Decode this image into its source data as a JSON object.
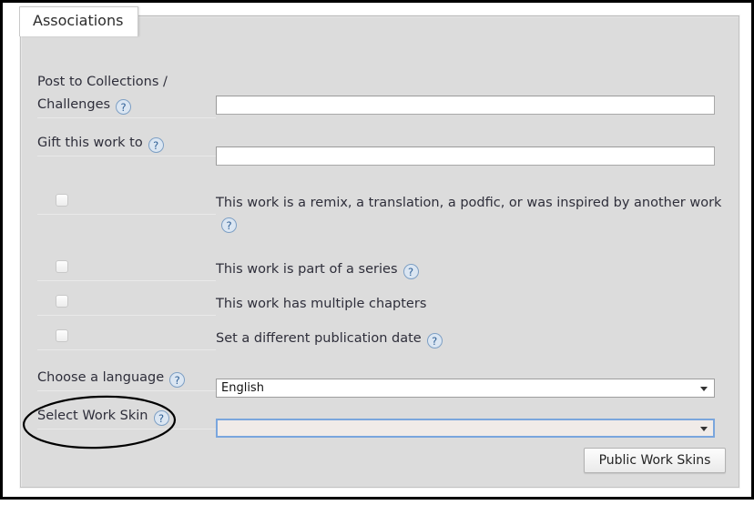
{
  "window": {
    "tab_label": "Associations"
  },
  "form": {
    "fields": [
      {
        "id": "post-to-collections",
        "label_line1": "Post to Collections /",
        "label_line2": "Challenges",
        "help_icon": "question-mark-icon",
        "help_glyph": "?",
        "input_value": "",
        "input_placeholder": ""
      },
      {
        "id": "gift-this-work-to",
        "label": "Gift this work to",
        "help_icon": "question-mark-icon",
        "help_glyph": "?",
        "input_value": "",
        "input_placeholder": ""
      }
    ],
    "checkboxes": [
      {
        "id": "remix-translation-podfic",
        "checked": false,
        "description": "This work is a remix, a translation, a podfic, or was inspired by another work",
        "has_help": true,
        "help_glyph": "?"
      },
      {
        "id": "part-of-series",
        "checked": false,
        "description": "This work is part of a series",
        "has_help": true,
        "help_glyph": "?"
      },
      {
        "id": "multiple-chapters",
        "checked": false,
        "description": "This work has multiple chapters",
        "has_help": false,
        "help_glyph": "?"
      },
      {
        "id": "different-publication-date",
        "checked": false,
        "description": "Set a different publication date",
        "has_help": true,
        "help_glyph": "?"
      }
    ],
    "language": {
      "label": "Choose a language",
      "help_glyph": "?",
      "selected": "English"
    },
    "work_skin": {
      "label": "Select Work Skin",
      "help_glyph": "?",
      "selected": "",
      "focused": true
    },
    "public_work_skins_button": "Public Work Skins"
  },
  "colors": {
    "panel_bg": "#dcdcdc",
    "help_blue": "#2c5d94",
    "focus_blue": "#7aa6dd",
    "annotation": "#000000"
  }
}
